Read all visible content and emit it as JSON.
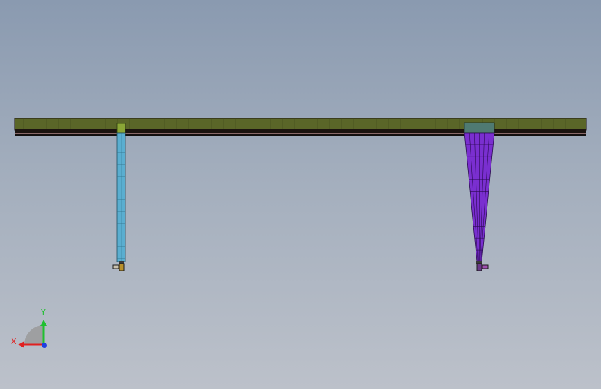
{
  "viewport": {
    "background_top": "#8a9ab0",
    "background_bottom": "#bcc1ca"
  },
  "model": {
    "girder_color": "#5a6628",
    "girder_dark": "#1c1410",
    "rigid_leg_color": "#5aaed0",
    "rigid_leg_cap_color": "#8aa636",
    "flexible_leg_color": "#7a2fd0",
    "flexible_leg_cap_color": "#4f7a72",
    "foot_color": "#b8902a"
  },
  "triad": {
    "x_label": "X",
    "y_label": "Y",
    "x_color": "#e02020",
    "y_color": "#20c030",
    "z_color": "#2040e0"
  }
}
